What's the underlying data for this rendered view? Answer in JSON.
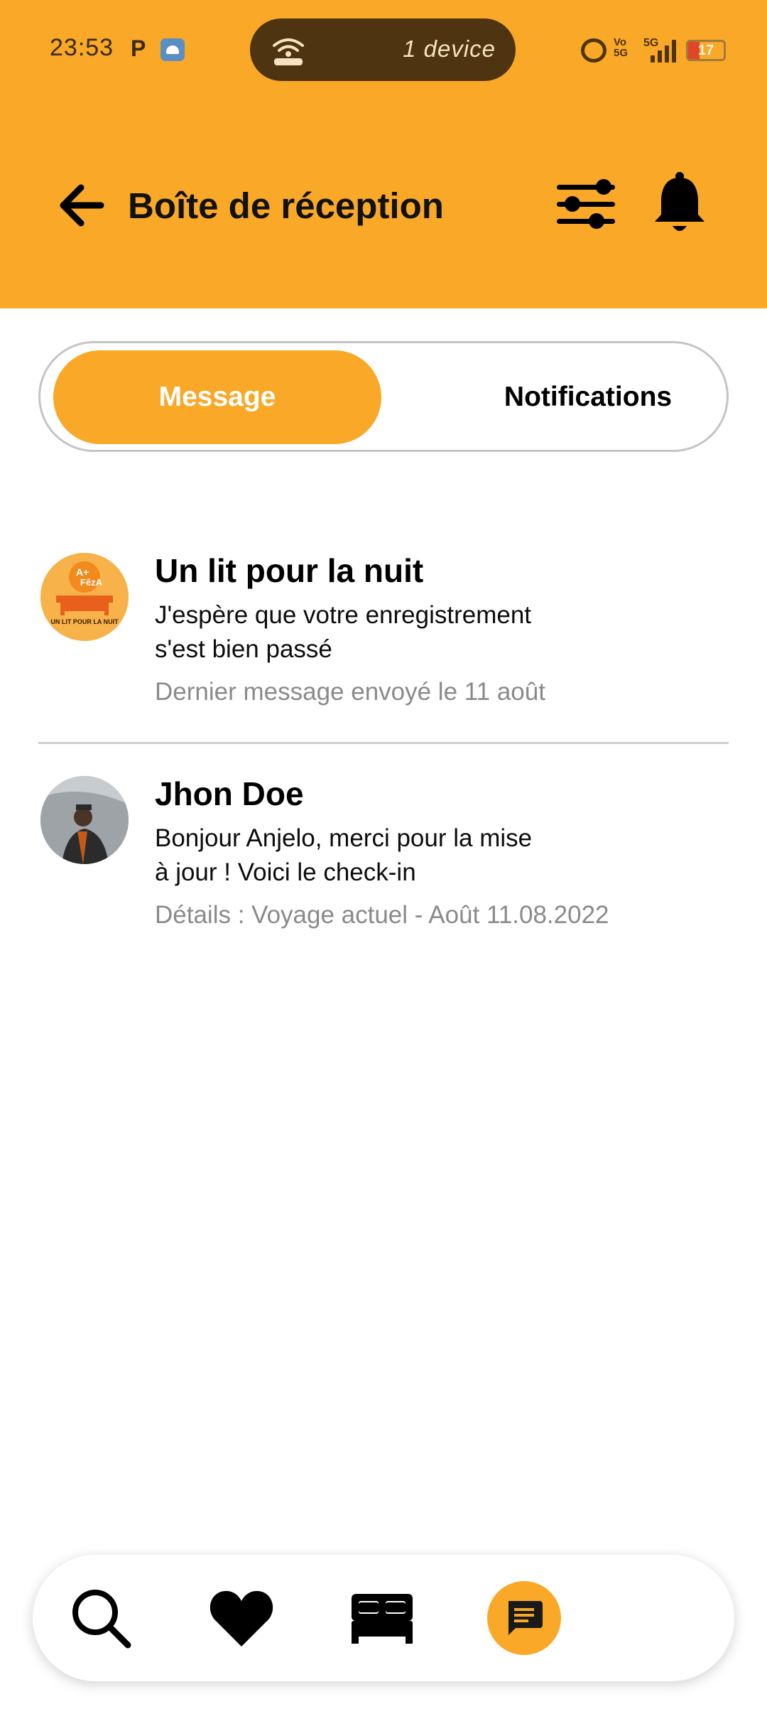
{
  "status_bar": {
    "time": "23:53",
    "p_glyph": "P",
    "hotspot_text": "1 device",
    "vo_top": "Vo",
    "vo_bottom": "5G",
    "net_5g": "5G",
    "battery": "17"
  },
  "header": {
    "title": "Boîte de réception",
    "icons": [
      "back-arrow-icon",
      "filter-sliders-icon",
      "bell-icon"
    ],
    "background": "#F9A827"
  },
  "tabs": {
    "message_label": "Message",
    "notifications_label": "Notifications",
    "active": "Message"
  },
  "messages": [
    {
      "name": "Un lit pour la nuit",
      "text": "J'espère que votre enregistrement s'est bien passé",
      "meta": "Dernier message envoyé le 11 août",
      "logo_line1": "A+",
      "logo_line2": "FêzA",
      "logo_caption": "UN LIT POUR LA NUIT"
    },
    {
      "name": "Jhon Doe",
      "text": "Bonjour Anjelo, merci pour la mise à jour ! Voici le check-in",
      "meta": "Détails : Voyage actuel - Août 11.08.2022"
    }
  ],
  "bottom_nav": {
    "items": [
      "search-icon",
      "heart-icon",
      "bed-icon",
      "chat-icon"
    ],
    "active": "chat-icon",
    "accent": "#F9A827"
  }
}
